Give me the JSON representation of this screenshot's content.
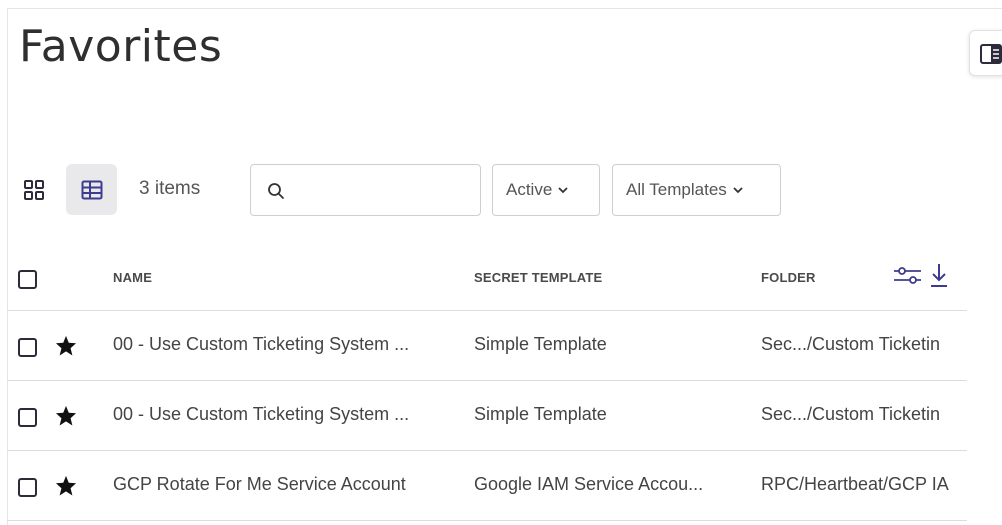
{
  "page": {
    "title": "Favorites"
  },
  "toolbar": {
    "item_count": "3 items",
    "search": {
      "value": "",
      "placeholder": ""
    },
    "status_filter": "Active",
    "template_filter": "All Templates"
  },
  "table": {
    "columns": [
      "NAME",
      "SECRET TEMPLATE",
      "FOLDER"
    ],
    "rows": [
      {
        "name": "00 - Use Custom Ticketing System ...",
        "template": "Simple Template",
        "folder": "Sec.../Custom Ticketin",
        "favorite": true
      },
      {
        "name": "00 - Use Custom Ticketing System ...",
        "template": "Simple Template",
        "folder": "Sec.../Custom Ticketin",
        "favorite": true
      },
      {
        "name": "GCP Rotate For Me Service Account",
        "template": "Google IAM Service Accou...",
        "folder": "RPC/Heartbeat/GCP IA",
        "favorite": true
      }
    ]
  },
  "icons": {
    "view_grid": "grid-view-icon",
    "view_table": "table-view-icon",
    "search": "search-icon",
    "panel": "side-panel-icon",
    "column_settings": "sliders-icon",
    "export": "download-icon",
    "favorite": "star-icon"
  },
  "colors": {
    "accent": "#3d3b8e",
    "text": "#444444",
    "border": "#cfcfcf"
  }
}
